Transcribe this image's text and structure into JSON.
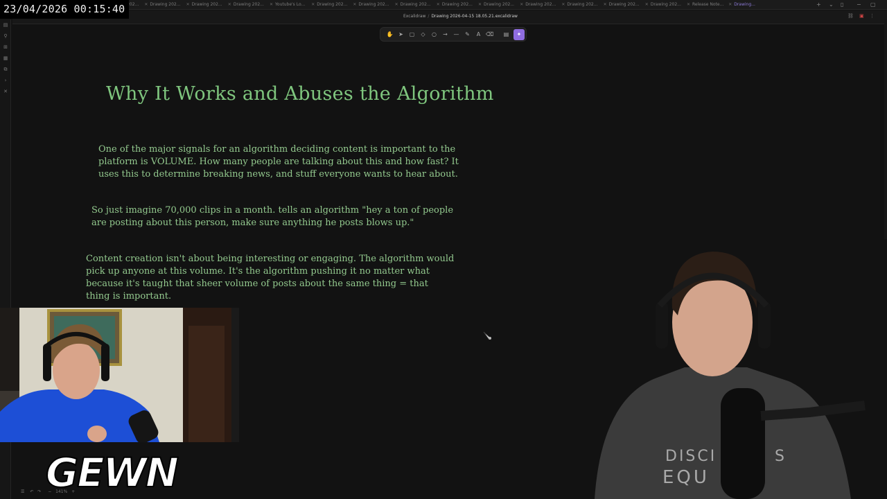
{
  "overlay": {
    "timestamp": "23/04/2026 00:15:40"
  },
  "tabs": [
    {
      "label": "Drawing 202...",
      "active": false
    },
    {
      "label": "Drawing 202...",
      "active": false
    },
    {
      "label": "Drawing 202...",
      "active": false
    },
    {
      "label": "Drawing 202...",
      "active": false
    },
    {
      "label": "Drawing 202...",
      "active": false
    },
    {
      "label": "Youtube's Lo...",
      "active": false
    },
    {
      "label": "Drawing 202...",
      "active": false
    },
    {
      "label": "Drawing 202...",
      "active": false
    },
    {
      "label": "Drawing 202...",
      "active": false
    },
    {
      "label": "Drawing 202...",
      "active": false
    },
    {
      "label": "Drawing 202...",
      "active": false
    },
    {
      "label": "Drawing 202...",
      "active": false
    },
    {
      "label": "Drawing 202...",
      "active": false
    },
    {
      "label": "Drawing 202...",
      "active": false
    },
    {
      "label": "Drawing 202...",
      "active": false
    },
    {
      "label": "Release Note...",
      "active": false
    },
    {
      "label": "Drawing...",
      "active": true
    }
  ],
  "titlebar": {
    "folder": "Excalidraw",
    "separator": "/",
    "file": "Drawing 2026-04-15 18.05.21.excalidraw"
  },
  "toolbar": {
    "tools": [
      "hand-tool",
      "selection-tool",
      "rectangle-tool",
      "diamond-tool",
      "ellipse-tool",
      "arrow-tool",
      "line-tool",
      "draw-tool",
      "text-tool",
      "eraser-tool",
      "library-tool",
      "laser-pointer-tool"
    ],
    "glyphs": [
      "✋",
      "➤",
      "▢",
      "◇",
      "○",
      "→",
      "—",
      "✎",
      "A",
      "⌫",
      "▤",
      "✦"
    ],
    "active_tool": "laser-pointer-tool"
  },
  "canvas": {
    "heading": "Why It Works and Abuses the Algorithm",
    "paragraph1": [
      "One of the major signals for an algorithm deciding content is important to the",
      "platform is VOLUME. How many people are talking about this and how fast? It",
      "uses this to determine breaking news, and stuff everyone wants to hear about."
    ],
    "paragraph2": [
      "So just imagine 70,000 clips in a month. tells an algorithm \"hey a ton of people",
      "are posting about this person, make sure anything he posts blows up.\""
    ],
    "paragraph3": [
      "Content creation isn't about being interesting or engaging. The algorithm would",
      "pick up anyone at this volume. It's the algorithm pushing it no matter what",
      "because it's taught that sheer volume of posts about the same thing = that",
      "thing is important."
    ]
  },
  "status": {
    "zoom": "141%"
  },
  "logo": {
    "text": "GEWN"
  },
  "colors": {
    "canvas_bg": "#121212",
    "text_green": "#93c98e",
    "heading_green": "#7fc67e",
    "accent": "#8f6ce0"
  }
}
